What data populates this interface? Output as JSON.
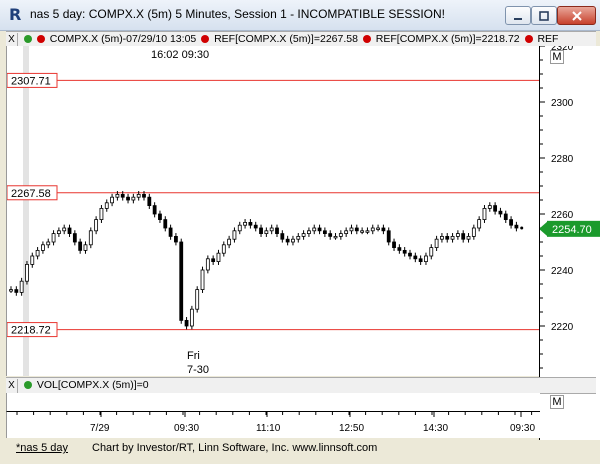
{
  "window": {
    "title": "nas 5 day: COMPX.X (5m) 5 Minutes, Session 1 - INCOMPATIBLE SESSION!",
    "buttons": [
      "minimize",
      "maximize",
      "close"
    ]
  },
  "ref_header": {
    "x_label": "X",
    "series_label": "COMPX.X (5m)-07/29/10 13:05",
    "ref1": "REF[COMPX.X (5m)]=2267.58",
    "ref2": "REF[COMPX.X (5m)]=2218.72",
    "ref3": "REF"
  },
  "top_time_label": "16:02  09:30",
  "fri_label_day": "Fri",
  "fri_label_date": "7-30",
  "ref_lines": [
    {
      "label": "2307.71",
      "value": 2307.71
    },
    {
      "label": "2267.58",
      "value": 2267.58
    },
    {
      "label": "2218.72",
      "value": 2218.72
    }
  ],
  "current_price": {
    "label": "2254.70",
    "value": 2254.7
  },
  "price_axis": {
    "ticks": [
      "2320",
      "2300",
      "2280",
      "2260",
      "2240",
      "2220"
    ],
    "min": 2200,
    "max": 2320
  },
  "vol_header": {
    "x_label": "X",
    "label": "VOL[COMPX.X (5m)]=0"
  },
  "time_axis": {
    "ticks": [
      "7/29",
      "09:30",
      "11:10",
      "12:50",
      "14:30",
      "09:30"
    ]
  },
  "m_button": "M",
  "status": {
    "tab": "*nas 5 day",
    "credit": "Chart by Investor/RT, Linn Software, Inc. www.linnsoft.com"
  },
  "chart_data": {
    "type": "line",
    "ylim": [
      2200,
      2320
    ],
    "series": [
      {
        "values": [
          2233,
          2232,
          2236,
          2242,
          2245,
          2247,
          2249,
          2250,
          2253,
          2254,
          2255,
          2253,
          2250,
          2247,
          2249,
          2254,
          2258,
          2262,
          2264,
          2266,
          2267,
          2266,
          2265,
          2266,
          2267,
          2266,
          2263,
          2260,
          2258,
          2255,
          2252,
          2250,
          2222,
          2220,
          2226,
          2233,
          2240,
          2244,
          2243,
          2246,
          2249,
          2251,
          2254,
          2256,
          2257,
          2256,
          2255,
          2253,
          2254,
          2255,
          2253,
          2251,
          2250,
          2251,
          2252,
          2253,
          2254,
          2255,
          2254,
          2253,
          2252,
          2252,
          2253,
          2254,
          2255,
          2254,
          2254,
          2254,
          2255,
          2255,
          2254,
          2250,
          2248,
          2247,
          2246,
          2245,
          2244,
          2243,
          2245,
          2248,
          2251,
          2252,
          2251,
          2252,
          2253,
          2251,
          2252,
          2255,
          2258,
          2262,
          2263,
          2261,
          2260,
          2258,
          2256,
          2255
        ]
      }
    ]
  }
}
